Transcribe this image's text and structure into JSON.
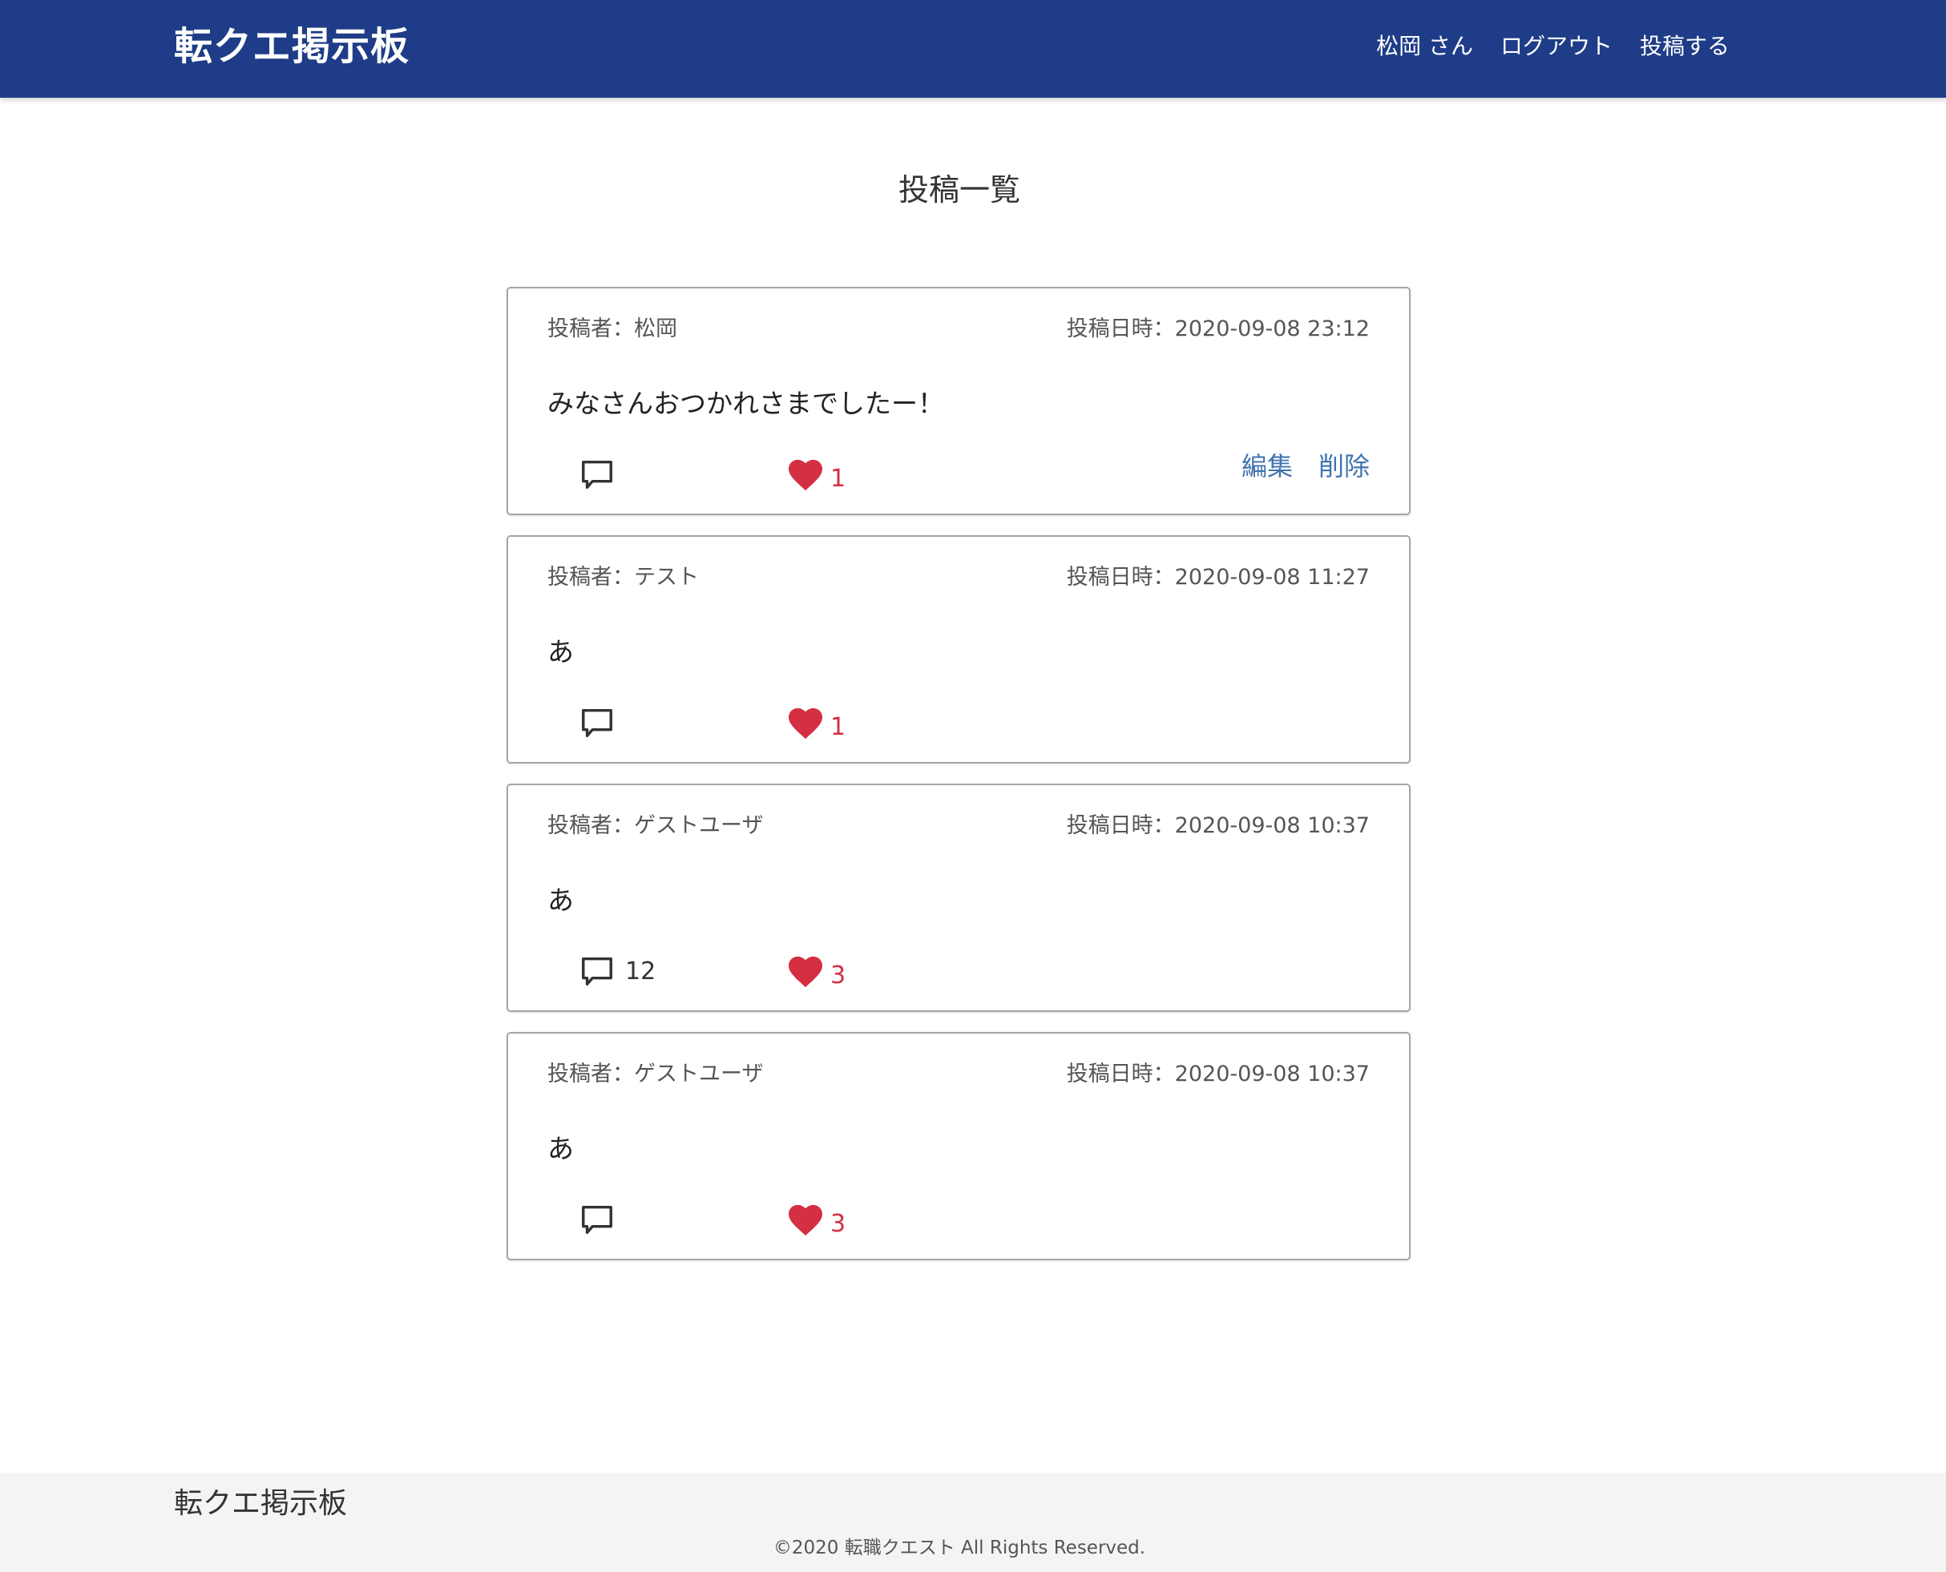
{
  "header": {
    "logo": "転クエ掲示板",
    "nav": {
      "user": "松岡 さん",
      "logout": "ログアウト",
      "post": "投稿する"
    }
  },
  "page_title": "投稿一覧",
  "posts": [
    {
      "author": "投稿者：松岡",
      "date": "投稿日時：2020-09-08 23:12",
      "body": "みなさんおつかれさまでしたー！",
      "comment_count": "",
      "like_count": "1",
      "edit_label": "編集",
      "delete_label": "削除"
    },
    {
      "author": "投稿者：テスト",
      "date": "投稿日時：2020-09-08 11:27",
      "body": "あ",
      "comment_count": "",
      "like_count": "1"
    },
    {
      "author": "投稿者：ゲストユーザ",
      "date": "投稿日時：2020-09-08 10:37",
      "body": "あ",
      "comment_count": "12",
      "like_count": "3"
    },
    {
      "author": "投稿者：ゲストユーザ",
      "date": "投稿日時：2020-09-08 10:37",
      "body": "あ",
      "comment_count": "",
      "like_count": "3"
    }
  ],
  "icons": {
    "comment": "comment-icon",
    "like": "heart-icon"
  },
  "colors": {
    "header_bg": "#1e3c87",
    "like": "#d42f42",
    "action_link": "#3f73b0",
    "footer_bg": "#f4f4f4"
  },
  "footer": {
    "logo": "転クエ掲示板",
    "copyright": "©2020 転職クエスト All Rights Reserved."
  }
}
